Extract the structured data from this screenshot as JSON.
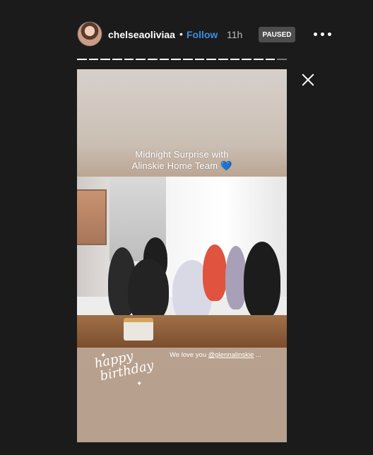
{
  "header": {
    "username": "chelseaoliviaa",
    "separator": "•",
    "follow_label": "Follow",
    "time_ago": "11h",
    "status_badge": "PAUSED"
  },
  "icons": {
    "avatar": "profile-avatar",
    "more": "more-options-icon",
    "close": "close-icon"
  },
  "progress": {
    "segments_total": 18,
    "segments_complete": 17
  },
  "story": {
    "caption_line1": "Midnight Surprise with",
    "caption_line2": "Alinskie Home Team 💙",
    "sticker_line1": "happy",
    "sticker_line2": "birthday",
    "love_prefix": "We love you ",
    "mention": "@glennalinskie",
    "love_suffix": " ..."
  },
  "colors": {
    "background": "#1b1b1b",
    "follow": "#3a8fe3",
    "paused_badge": "#4d4d4d"
  }
}
